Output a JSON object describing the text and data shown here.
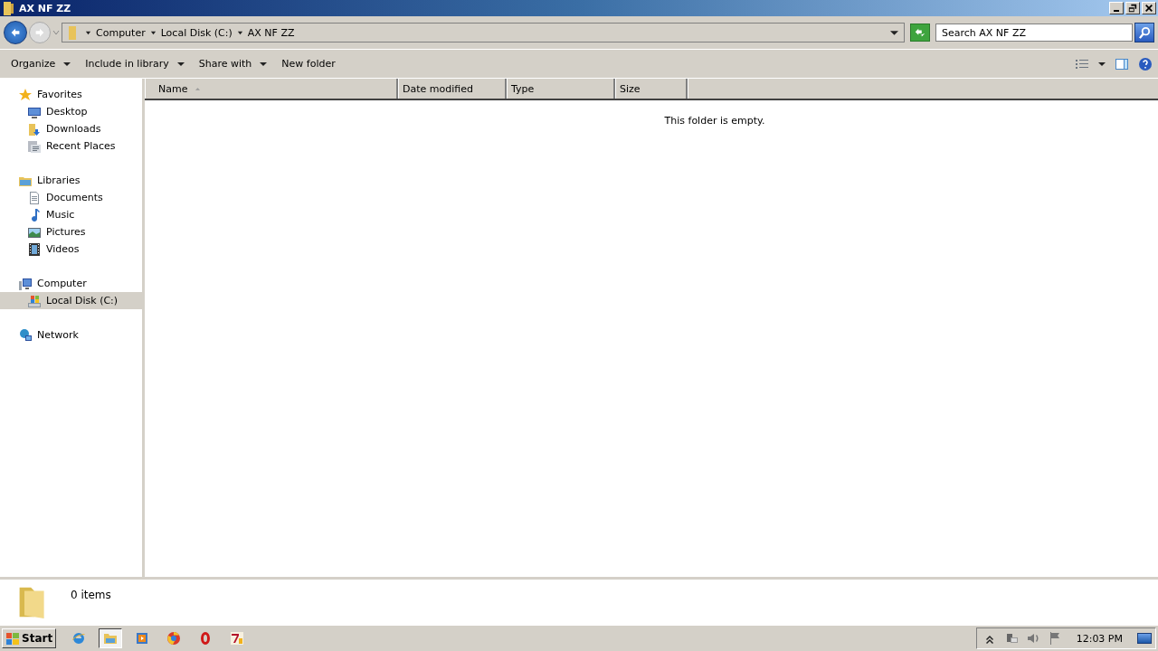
{
  "window": {
    "title": "AX NF ZZ"
  },
  "address_bar": {
    "breadcrumb": [
      "Computer",
      "Local Disk (C:)",
      "AX NF ZZ"
    ]
  },
  "search": {
    "placeholder": "Search AX NF ZZ"
  },
  "toolbar": [
    {
      "label": "Organize",
      "dropdown": true
    },
    {
      "label": "Include in library",
      "dropdown": true
    },
    {
      "label": "Share with",
      "dropdown": true
    },
    {
      "label": "New folder",
      "dropdown": false
    }
  ],
  "sidebar": {
    "groups": [
      {
        "label": "Favorites",
        "selected": false,
        "children": [
          {
            "label": "Desktop",
            "selected": false
          },
          {
            "label": "Downloads",
            "selected": false
          },
          {
            "label": "Recent Places",
            "selected": false
          }
        ]
      },
      {
        "label": "Libraries",
        "selected": false,
        "children": [
          {
            "label": "Documents",
            "selected": false
          },
          {
            "label": "Music",
            "selected": false
          },
          {
            "label": "Pictures",
            "selected": false
          },
          {
            "label": "Videos",
            "selected": false
          }
        ]
      },
      {
        "label": "Computer",
        "selected": false,
        "children": [
          {
            "label": "Local Disk (C:)",
            "selected": true
          }
        ]
      },
      {
        "label": "Network",
        "selected": false
      }
    ]
  },
  "columns": [
    {
      "label": "Name",
      "sorted": true
    },
    {
      "label": "Date modified",
      "sorted": false
    },
    {
      "label": "Type",
      "sorted": false
    },
    {
      "label": "Size",
      "sorted": false
    }
  ],
  "empty_message": "This folder is empty.",
  "details_pane": {
    "count": "0 items"
  },
  "taskbar": {
    "start": "Start",
    "apps": [
      {
        "kind": "browser",
        "active": false
      },
      {
        "kind": "explorer",
        "active": true
      },
      {
        "kind": "media",
        "active": false
      },
      {
        "kind": "globe",
        "active": false
      },
      {
        "kind": "ring",
        "active": false
      },
      {
        "kind": "archiver",
        "active": false
      }
    ],
    "clock": "12:03 PM"
  }
}
